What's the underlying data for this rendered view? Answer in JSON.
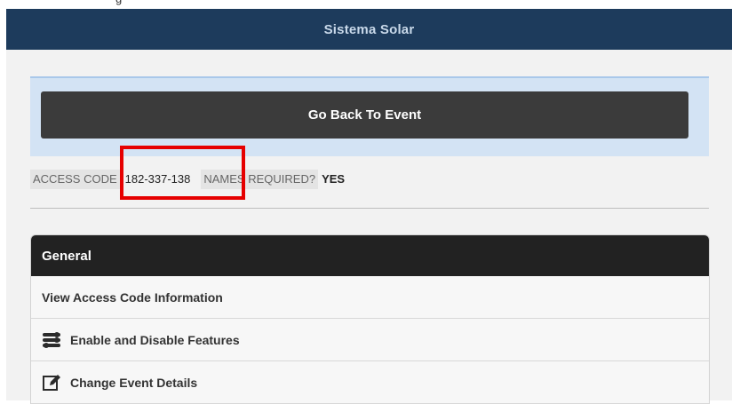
{
  "top_fragment": "g",
  "header": {
    "title": "Sistema Solar"
  },
  "actions": {
    "back_label": "Go Back To Event"
  },
  "access": {
    "code_label": "ACCESS CODE",
    "code_value": "182-337-138",
    "names_label": "NAMES REQUIRED?",
    "names_value": "YES"
  },
  "general": {
    "title": "General",
    "items": [
      {
        "label": "View Access Code Information",
        "icon": ""
      },
      {
        "label": "Enable and Disable Features",
        "icon": "toggles-icon"
      },
      {
        "label": "Change Event Details",
        "icon": "edit-icon"
      }
    ]
  },
  "colors": {
    "header_bg": "#1d3b5c",
    "button_bg": "#3b3b3b",
    "highlight": "#e60000",
    "card_header_bg": "#222222"
  }
}
